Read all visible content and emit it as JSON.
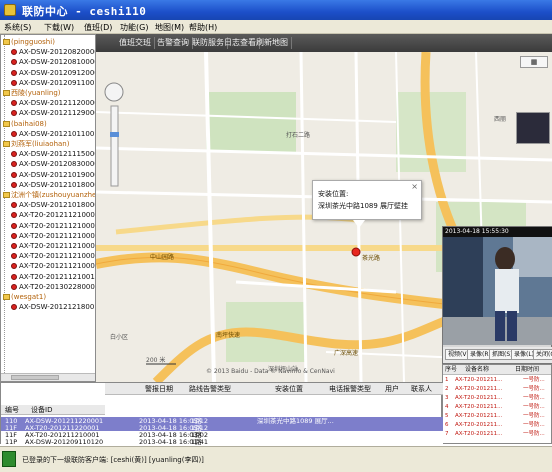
{
  "window": {
    "title": "联防中心 - ceshi110"
  },
  "menu": [
    "系统(S)",
    "下载(W)",
    "值班(D)",
    "功能(G)",
    "地图(M)",
    "帮助(H)"
  ],
  "tree": [
    {
      "type": "group",
      "label": "(pingguoshi)"
    },
    {
      "type": "device",
      "label": "AX-DSW-201208200001"
    },
    {
      "type": "device",
      "label": "AX-DSW-201208100001"
    },
    {
      "type": "device",
      "label": "AX-DSW-201209120001"
    },
    {
      "type": "device",
      "label": "AX-DSW-201209110016"
    },
    {
      "type": "group",
      "label": "西陵(yuanling)"
    },
    {
      "type": "device",
      "label": "AX-DSW-201211200001"
    },
    {
      "type": "device",
      "label": "AX-DSW-201211290001"
    },
    {
      "type": "group",
      "label": "(baihai08)"
    },
    {
      "type": "device",
      "label": "AX-DSW-201210110013"
    },
    {
      "type": "group",
      "label": "刘燕军(liuiaohan)"
    },
    {
      "type": "device",
      "label": "AX-DSW-201211150001"
    },
    {
      "type": "device",
      "label": "AX-DSW-201208300001"
    },
    {
      "type": "device",
      "label": "AX-DSW-201210190001"
    },
    {
      "type": "device",
      "label": "AX-DSW-201210180001"
    },
    {
      "type": "group",
      "label": "沈洲个镇(zushouyuanzhen)"
    },
    {
      "type": "device",
      "label": "AX-DSW-201210180001"
    },
    {
      "type": "device",
      "label": "AX-T20-201211210001"
    },
    {
      "type": "device",
      "label": "AX-T20-201211210002"
    },
    {
      "type": "device",
      "label": "AX-T20-201211210003"
    },
    {
      "type": "device",
      "label": "AX-T20-201211210004"
    },
    {
      "type": "device",
      "label": "AX-T20-201211210005"
    },
    {
      "type": "device",
      "label": "AX-T20-201211210006"
    },
    {
      "type": "device",
      "label": "AX-T20-201211210017"
    },
    {
      "type": "device",
      "label": "AX-T20-201302280001"
    },
    {
      "type": "group",
      "label": "(wesgat1)"
    },
    {
      "type": "device",
      "label": "AX-DSW-201212180017"
    }
  ],
  "map_tabs": [
    "值班交班",
    "告警查询",
    "联防服务",
    "日志查看",
    "刷新地图"
  ],
  "map": {
    "popup_title": "安装位置:",
    "popup_address": "深圳茶光中路1089 展厅壁挂",
    "labels": [
      "打石二路",
      "中山园路",
      "茶光路",
      "南坪快速",
      "广深高速",
      "深圳坪山站",
      "白小区",
      "西丽"
    ],
    "scale": "200 米",
    "copyright": "© 2013 Baidu - Data © Navinfo & CenNavi"
  },
  "video": {
    "header": "2013-04-18 15:55:30",
    "buttons": [
      "视频(V)",
      "录像(R)",
      "抓图(S)",
      "录像(L)",
      "关闭(C)"
    ]
  },
  "right_table": {
    "headers": [
      "序号",
      "设备名称",
      "日期时间"
    ],
    "rows": [
      [
        "1",
        "AX-T20-201211...",
        "一号防..."
      ],
      [
        "2",
        "AX-T20-201211...",
        "一号防..."
      ],
      [
        "3",
        "AX-T20-201211...",
        "一号防..."
      ],
      [
        "4",
        "AX-T20-201211...",
        "一号防..."
      ],
      [
        "5",
        "AX-T20-201211...",
        "一号防..."
      ],
      [
        "6",
        "AX-T20-201211...",
        "一号防..."
      ],
      [
        "7",
        "AX-T20-201211...",
        "一号防..."
      ]
    ]
  },
  "alarm_table": {
    "headers_top": [
      "警报日期",
      "路线告警类型",
      "安装位置",
      "电话报警类型",
      "用户",
      "联系人"
    ],
    "headers_left": [
      "编号",
      "设备ID"
    ],
    "rows": [
      {
        "no": "110",
        "id": "AX-DSW-201211220001",
        "time": "2013-04-18 16:05:12",
        "type": "1路",
        "addr": "深圳茶光中路1089 展厅...",
        "selected": true
      },
      {
        "no": "11F",
        "id": "AX-T20-201211220001",
        "time": "2013-04-18 16:05:12",
        "type": "1路",
        "addr": "",
        "selected": true
      },
      {
        "no": "11F",
        "id": "AX-T20-201211210001",
        "time": "2013-04-18 16:03:02",
        "type": "1路",
        "addr": "",
        "selected": false
      },
      {
        "no": "11P",
        "id": "AX-DSW-201209110120",
        "time": "2013-04-18 16:01:41",
        "type": "1路",
        "addr": "",
        "selected": false
      }
    ]
  },
  "status": {
    "text": "已登录的下一级联防客户端: [ceshi(黄)] [yuanling(李四)]"
  }
}
